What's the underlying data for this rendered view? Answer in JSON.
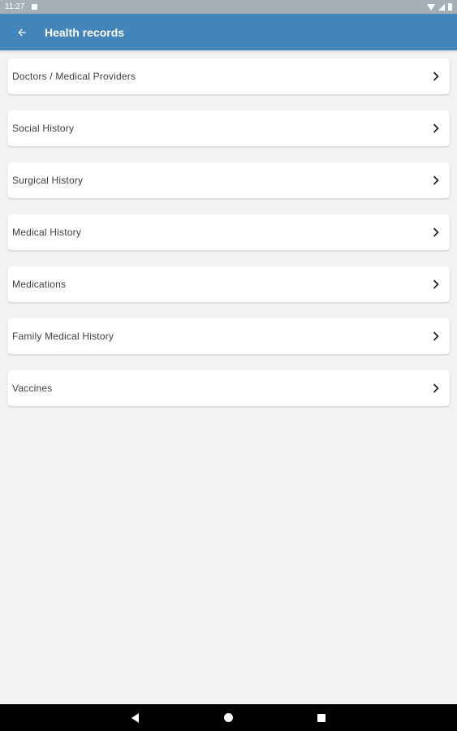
{
  "status_bar": {
    "time": "11:27",
    "icons": [
      "notification-icon",
      "wifi-icon",
      "signal-icon",
      "battery-icon"
    ]
  },
  "app_bar": {
    "title": "Health records",
    "back_icon": "arrow-left-icon",
    "color": "#4384ba"
  },
  "records": {
    "items": [
      {
        "label": "Doctors / Medical Providers"
      },
      {
        "label": "Social History"
      },
      {
        "label": "Surgical History"
      },
      {
        "label": "Medical History"
      },
      {
        "label": "Medications"
      },
      {
        "label": "Family Medical History"
      },
      {
        "label": "Vaccines"
      }
    ],
    "item_icon": "chevron-right-icon"
  },
  "nav_bar": {
    "buttons": [
      "back-triangle-icon",
      "home-circle-icon",
      "recents-square-icon"
    ]
  }
}
